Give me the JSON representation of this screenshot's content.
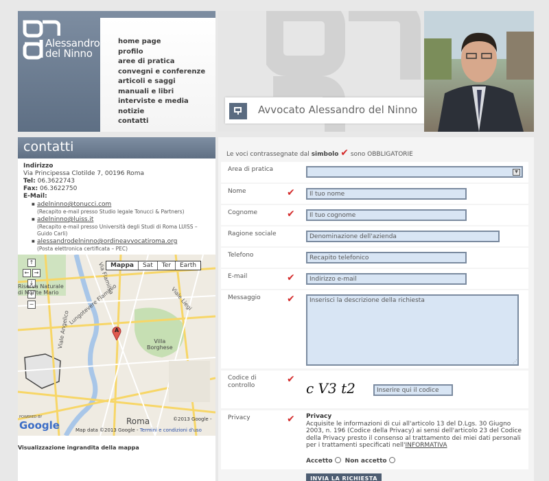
{
  "header": {
    "logo_line1": "Alessandro",
    "logo_line2": "del  Ninno",
    "banner_title": "Avvocato Alessandro del Ninno"
  },
  "nav": {
    "items": [
      "home page",
      "profilo",
      "aree di pratica",
      "convegni e conferenze",
      "articoli e saggi",
      "manuali e libri",
      "interviste e media",
      "notizie",
      "contatti"
    ]
  },
  "contact": {
    "heading": "contatti",
    "address_label": "Indirizzo",
    "address": "Via Principessa Clotilde 7, 00196 Roma",
    "tel_label": "Tel:",
    "tel": "06.3622743",
    "fax_label": "Fax:",
    "fax": "06.3622750",
    "email_label": "E-Mail:",
    "emails": [
      {
        "address": "adelninno@tonucci.com",
        "note": "(Recapito e-mail presso Studio legale Tonucci & Partners)"
      },
      {
        "address": "adelninno@luiss.it",
        "note": "(Recapito e-mail presso Università degli Studi di Roma LUISS – Guido Carli)"
      },
      {
        "address": "alessandrodelninno@ordineavvocatiroma.org",
        "note": "(Posta elettronica certificata – PEC)"
      }
    ]
  },
  "map": {
    "types": [
      "Mappa",
      "Sat",
      "Ter",
      "Earth"
    ],
    "selected_type": "Mappa",
    "labels": {
      "riserva": "Riserva Naturale",
      "monte_mario": "di Monte Mario",
      "lungotevere": "Lungotevere Flaminio",
      "flaminia": "Via Flaminia",
      "viale_angelico": "Viale Angelico",
      "viale_liegi": "Viale Liegi",
      "villa": "Villa",
      "borghese": "Borghese",
      "roma": "Roma",
      "marker": "A"
    },
    "powered_by": "POWERED BY",
    "google": "Google",
    "copyright": "©2013 Google -",
    "map_data": "Map data ©2013 Google -",
    "terms": "Termini e condizioni d'uso",
    "enlarge_link": "Visualizzazione ingrandita della mappa"
  },
  "form": {
    "required_note_pre": "Le voci contrassegnate dal",
    "required_note_bold": "simbolo",
    "required_note_post": "sono OBBLIGATORIE",
    "fields": {
      "area_label": "Area di pratica",
      "nome_label": "Nome",
      "nome_placeholder": "Il tuo nome",
      "cognome_label": "Cognome",
      "cognome_placeholder": "Il tuo cognome",
      "ragione_label": "Ragione sociale",
      "ragione_placeholder": "Denominazione dell'azienda",
      "telefono_label": "Telefono",
      "telefono_placeholder": "Recapito telefonico",
      "email_label": "E-mail",
      "email_placeholder": "Indirizzo e-mail",
      "messaggio_label": "Messaggio",
      "messaggio_placeholder": "Inserisci la descrizione della richiesta",
      "codice_label": "Codice di controllo",
      "codice_captcha": "c V3 t2",
      "codice_placeholder": "Inserire qui il codice",
      "privacy_label": "Privacy"
    },
    "privacy": {
      "title": "Privacy",
      "text": "Acquisite le informazioni di cui all'articolo 13 del D.Lgs. 30 Giugno 2003, n. 196 (Codice della Privacy) ai sensi dell'articolo 23 del Codice della Privacy presto il consenso al trattamento dei miei dati personali per i trattamenti specificati nell'",
      "link": "INFORMATIVA",
      "accept": "Accetto",
      "reject": "Non accetto"
    },
    "submit": "INVIA LA RICHIESTA"
  },
  "colors": {
    "accent": "#5e6f84",
    "required": "#d42b2b",
    "field_bg": "#d8e5f4"
  }
}
